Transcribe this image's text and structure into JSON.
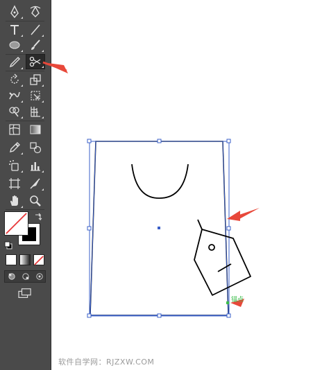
{
  "toolbar": {
    "selected_tool": "scissors-tool",
    "tools": [
      "pen-tool",
      "curvature-tool",
      "type-tool",
      "line-segment-tool",
      "ellipse-tool",
      "paintbrush-tool",
      "pencil-tool",
      "scissors-tool",
      "rotate-tool",
      "scale-tool",
      "warp-tool",
      "free-transform-tool",
      "shape-builder-tool",
      "perspective-grid-tool",
      "mesh-tool",
      "gradient-tool",
      "eyedropper-tool",
      "blend-tool",
      "symbol-sprayer-tool",
      "column-graph-tool",
      "artboard-tool",
      "slice-tool",
      "hand-tool",
      "zoom-tool"
    ]
  },
  "canvas": {
    "anchor_label": "锚点"
  },
  "colors": {
    "selection": "#3a5fc8",
    "arrow": "#e8483a",
    "smart_guide": "#3cbd4a"
  },
  "watermark": "软件自学网：RJZXW.COM"
}
